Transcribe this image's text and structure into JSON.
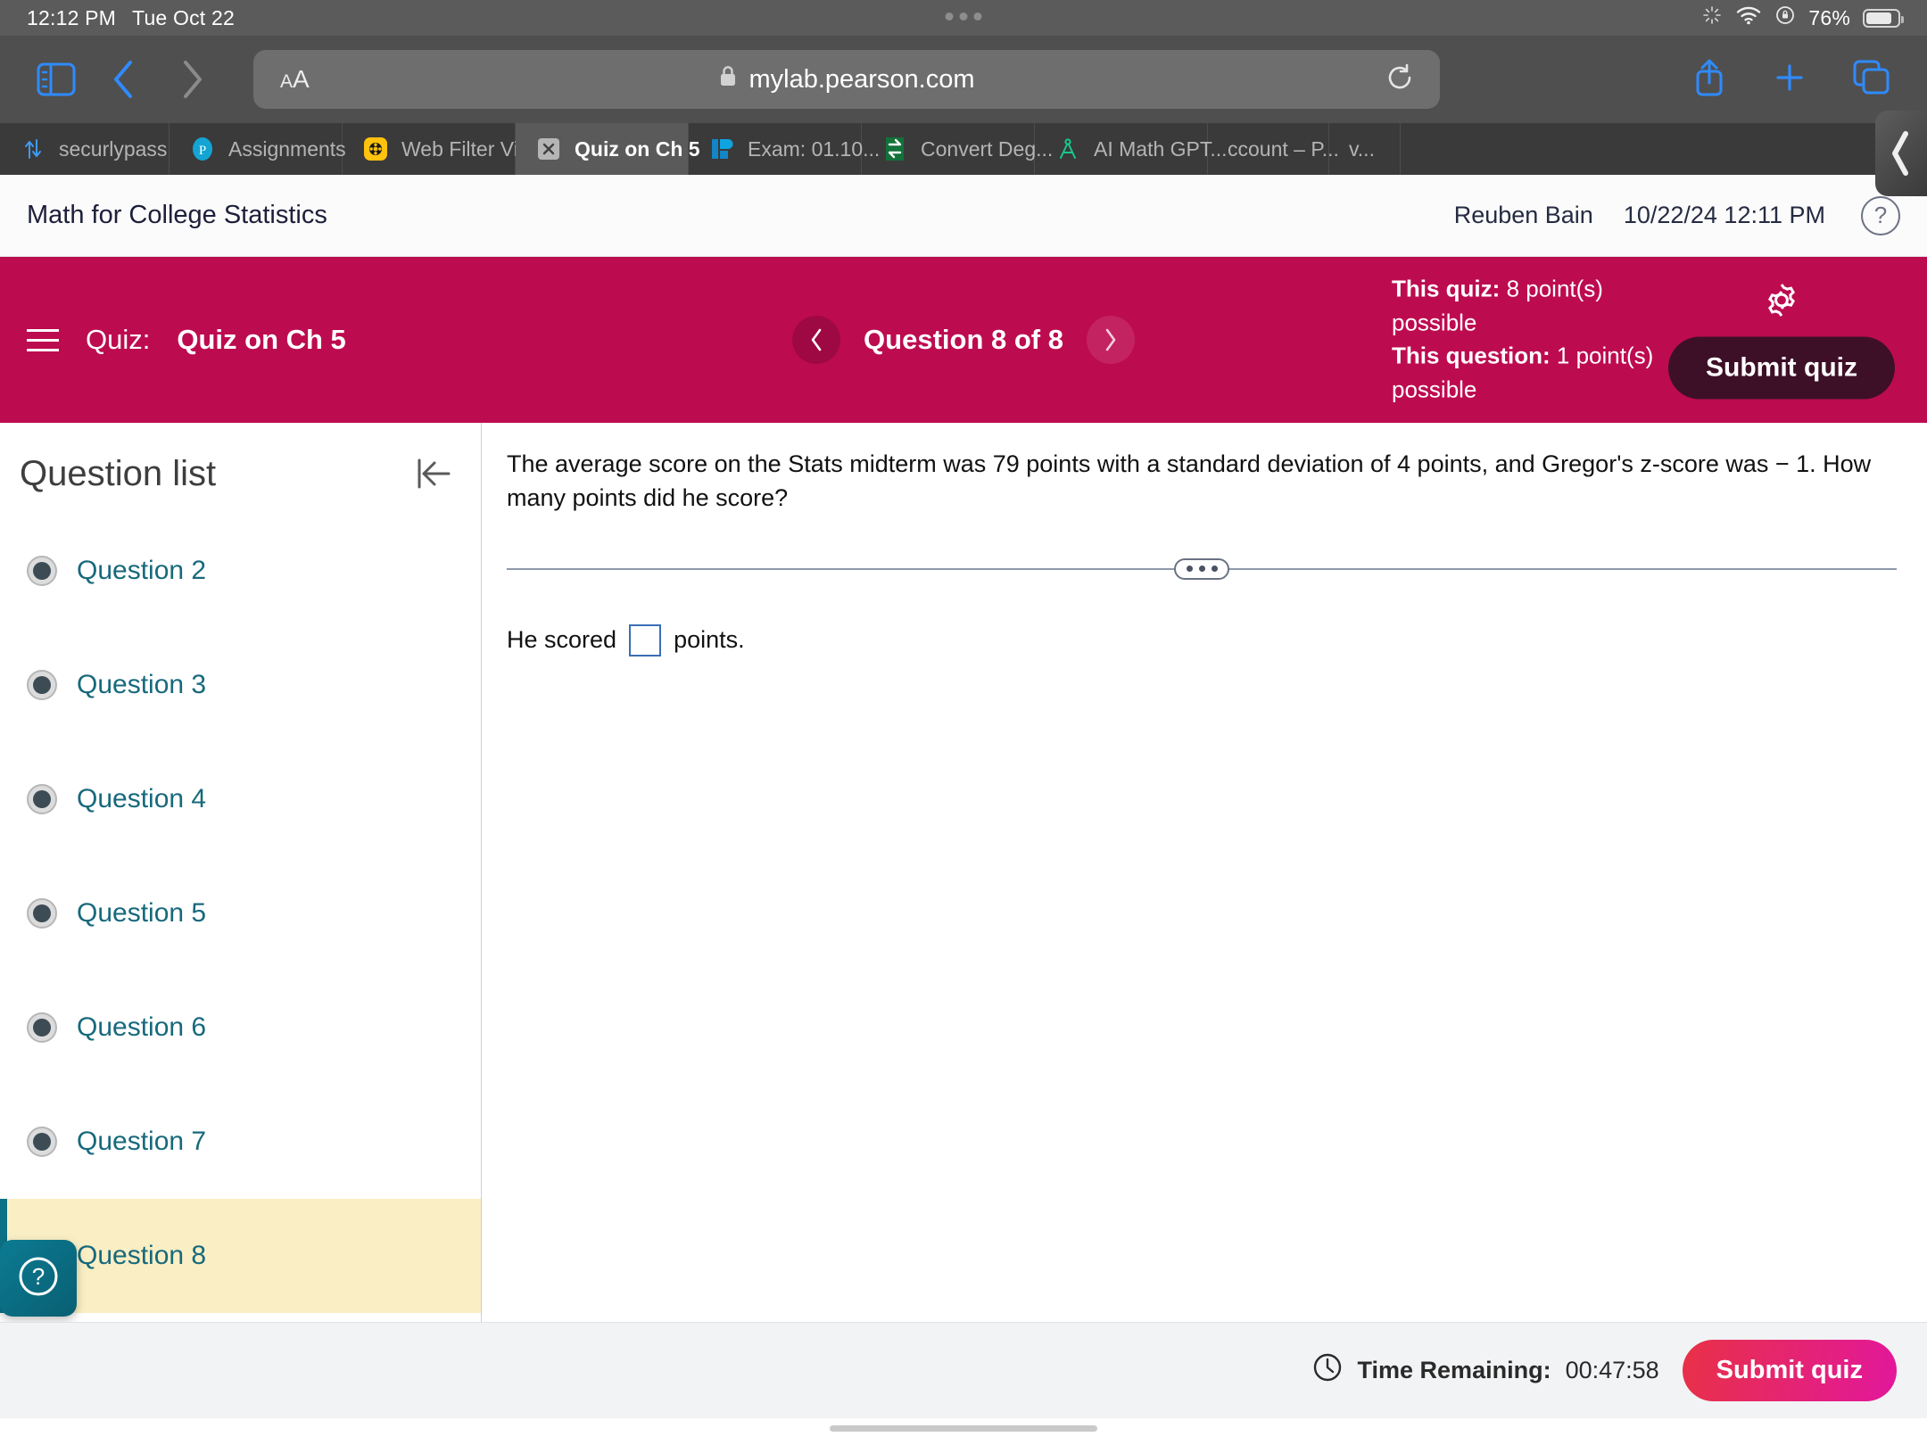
{
  "status_bar": {
    "time": "12:12 PM",
    "date": "Tue Oct 22",
    "battery_percent": "76%",
    "icons": [
      "brightness-icon",
      "wifi-icon",
      "rotation-lock-icon",
      "battery-icon"
    ]
  },
  "browser": {
    "sidebar_icon": "sidebar-toggle-icon",
    "back_icon": "back-chevron-icon",
    "forward_icon": "forward-chevron-icon",
    "aa_label_small": "A",
    "aa_label_large": "A",
    "url": "mylab.pearson.com",
    "lock_icon": "lock-icon",
    "reload_icon": "reload-icon",
    "share_icon": "share-icon",
    "new_tab_icon": "plus-icon",
    "tabs_icon": "tab-overview-icon",
    "tabs": [
      {
        "label": "securlypass",
        "favicon": "securly-arrows-icon",
        "active": false
      },
      {
        "label": "Assignments",
        "favicon": "pearson-p-icon",
        "active": false
      },
      {
        "label": "Web Filter Vi...",
        "favicon": "web-filter-icon",
        "active": false
      },
      {
        "label": "Quiz on Ch 5",
        "favicon": "x-box-icon",
        "active": true
      },
      {
        "label": "Exam: 01.10...",
        "favicon": "exam-icon",
        "active": false
      },
      {
        "label": "Convert Deg...",
        "favicon": "convert-icon",
        "active": false
      },
      {
        "label": "AI Math GPT...",
        "favicon": "compass-icon",
        "active": false
      },
      {
        "label": "ccount – P...",
        "favicon": "",
        "active": false
      },
      {
        "label": "v...",
        "favicon": "",
        "active": false
      }
    ]
  },
  "course_header": {
    "title": "Math for College Statistics",
    "user_name": "Reuben Bain",
    "timestamp": "10/22/24 12:11 PM",
    "help_icon": "question-mark-circle-icon"
  },
  "quiz_bar": {
    "menu_icon": "hamburger-menu-icon",
    "quiz_label": "Quiz:",
    "quiz_name": "Quiz on Ch 5",
    "prev_icon": "chevron-left-icon",
    "next_icon": "chevron-right-icon",
    "counter": "Question 8 of 8",
    "points_quiz_label": "This quiz:",
    "points_quiz_value": "8 point(s) possible",
    "points_question_label": "This question:",
    "points_question_value": "1 point(s) possible",
    "settings_icon": "gear-icon",
    "submit_label": "Submit quiz",
    "background_color": "#bd0b50",
    "submit_color": "#3e1028"
  },
  "sidebar": {
    "title": "Question list",
    "collapse_icon": "collapse-panel-left-icon",
    "help_fab_icon": "question-mark-circle-icon",
    "highlight_color": "#faeec4",
    "accent_color": "#0d7186",
    "items": [
      {
        "label": "Question 2",
        "status_icon": "answered-dot-icon",
        "current": false
      },
      {
        "label": "Question 3",
        "status_icon": "answered-dot-icon",
        "current": false
      },
      {
        "label": "Question 4",
        "status_icon": "answered-dot-icon",
        "current": false
      },
      {
        "label": "Question 5",
        "status_icon": "answered-dot-icon",
        "current": false
      },
      {
        "label": "Question 6",
        "status_icon": "answered-dot-icon",
        "current": false
      },
      {
        "label": "Question 7",
        "status_icon": "answered-dot-icon",
        "current": false
      },
      {
        "label": "Question 8",
        "status_icon": "answered-dot-icon",
        "current": true
      }
    ]
  },
  "question": {
    "text": "The average score on the Stats midterm was 79 points with a standard deviation of 4 points, and Gregor's z-score was  − 1. How many points did he score?",
    "divider_icon": "drag-handle-dots-icon",
    "answer_prefix": "He scored",
    "answer_value": "",
    "answer_suffix": "points."
  },
  "footer": {
    "clock_icon": "clock-icon",
    "time_label": "Time Remaining:",
    "time_value": "00:47:58",
    "submit_label": "Submit quiz"
  }
}
